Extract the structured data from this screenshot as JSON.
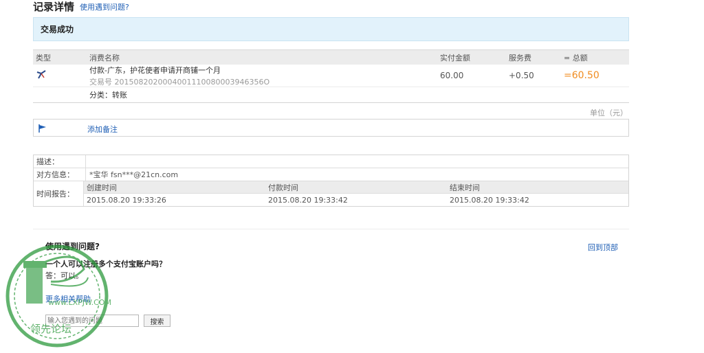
{
  "header": {
    "title": "记录详情",
    "help_link": "使用遇到问题?"
  },
  "status": {
    "text": "交易成功"
  },
  "record": {
    "columns": {
      "type": "类型",
      "name": "消费名称",
      "amount": "实付金额",
      "fee": "服务费",
      "total": "= 总额"
    },
    "item": {
      "title": "付款-广东，护花使者申请开商铺一个月",
      "tx_no": "交易号 2015082020004001110080003946356O",
      "amount": "60.00",
      "fee": "+0.50",
      "total": "=60.50"
    },
    "category": "分类：转账",
    "unit": "单位（元）"
  },
  "note": {
    "add_label": "添加备注"
  },
  "details": {
    "desc_label": "描述：",
    "desc_value": "",
    "party_label": "对方信息：",
    "party_value": "*宝华 fsn***@21cn.com",
    "time_label": "时间报告：",
    "time_headers": [
      "创建时间",
      "付款时间",
      "结束时间"
    ],
    "time_values": [
      "2015.08.20 19:33:26",
      "2015.08.20 19:33:42",
      "2015.08.20 19:33:42"
    ]
  },
  "faq": {
    "title": "使用遇到问题?",
    "back_top": "回到顶部",
    "question": "一个人可以注册多个支付宝账户吗？",
    "answer": "答：可以。",
    "more_help": "更多相关帮助",
    "search_placeholder": "输入您遇到的问题",
    "search_button": "搜索"
  },
  "watermark": {
    "text": "www.LXPJW.COM",
    "caption": "领先论坛"
  },
  "colors": {
    "accent_link": "#1f5fb5",
    "total_orange": "#f08c20",
    "status_bg": "#e2f2fb"
  },
  "icons": {
    "transfer": "transfer-icon",
    "flag": "flag-icon"
  }
}
